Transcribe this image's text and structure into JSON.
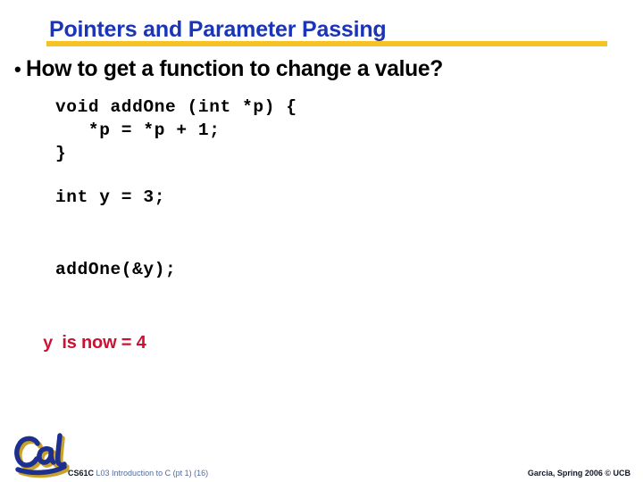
{
  "slide": {
    "title": "Pointers and Parameter Passing",
    "title_color": "#1a35b8",
    "rule_color": "#f5c424",
    "background": "#ffffff"
  },
  "bullet": {
    "marker": "•",
    "text": "How to get a function to change a value?"
  },
  "code": {
    "function_block": "void addOne (int *p) {\n   *p = *p + 1;\n}",
    "declaration": "int y = 3;",
    "call": "addOne(&y);",
    "color": "#000000"
  },
  "result": {
    "variable": "y",
    "text": "is now = 4",
    "color": "#cc1133"
  },
  "footer": {
    "logo_alt": "Cal",
    "logo_color": "#1d2f8f",
    "logo_shadow_color": "#c9a227",
    "course": "CS61C",
    "lecture": "L03 Introduction to C (pt 1) (16)",
    "credit": "Garcia, Spring 2006 © UCB"
  }
}
